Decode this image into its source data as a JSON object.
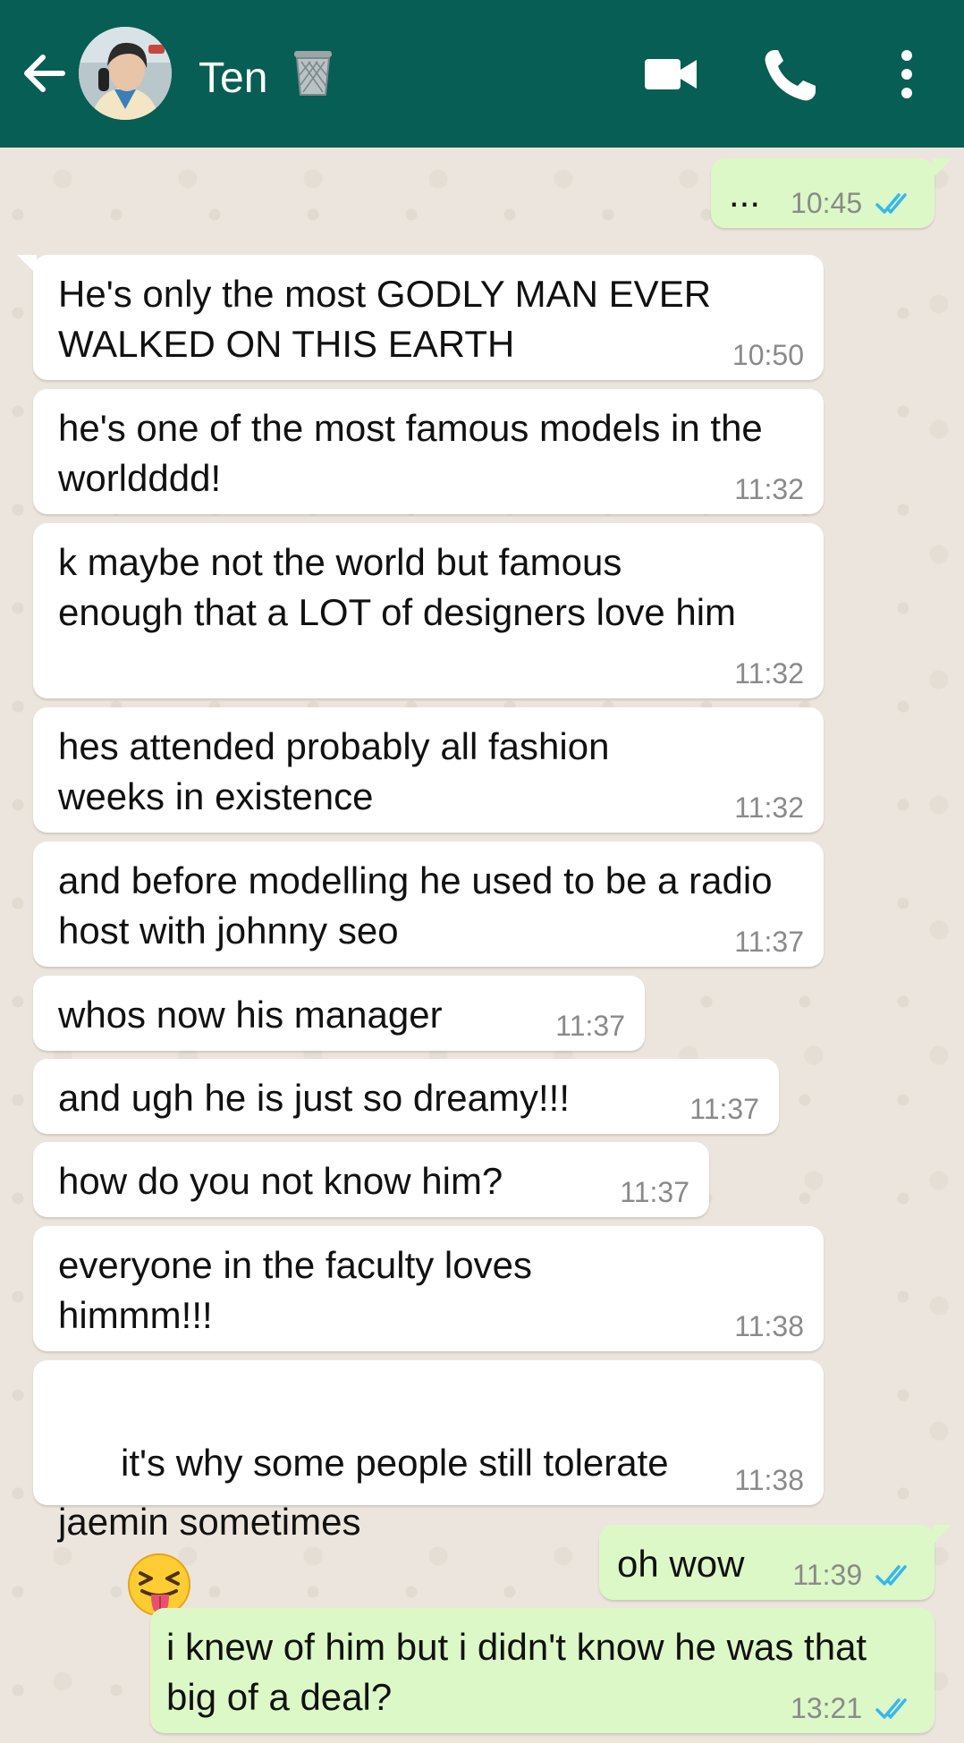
{
  "header": {
    "contact_name": "Ten",
    "colors": {
      "bar": "#075e54",
      "incoming": "#ffffff",
      "outgoing": "#dcf8c6",
      "read_ticks": "#34b7f1"
    }
  },
  "messages": [
    {
      "direction": "out",
      "text": "...",
      "time": "10:45",
      "status": "read"
    },
    {
      "direction": "in",
      "text": "He's only the most GODLY MAN EVER WALKED ON THIS EARTH",
      "time": "10:50"
    },
    {
      "direction": "in",
      "text": "he's one of the most famous models in the worldddd!",
      "time": "11:32"
    },
    {
      "direction": "in",
      "text": "k maybe not the world but famous enough that a LOT of designers love him",
      "time": "11:32"
    },
    {
      "direction": "in",
      "text": "hes attended probably all fashion weeks in existence",
      "time": "11:32"
    },
    {
      "direction": "in",
      "text": "and before modelling he used to be a radio host with johnny seo",
      "time": "11:37"
    },
    {
      "direction": "in",
      "text": "whos now his manager",
      "time": "11:37"
    },
    {
      "direction": "in",
      "text": "and ugh he is just so dreamy!!!",
      "time": "11:37"
    },
    {
      "direction": "in",
      "text": "how do you not know him?",
      "time": "11:37"
    },
    {
      "direction": "in",
      "text": "everyone in the faculty loves himmm!!!",
      "time": "11:38"
    },
    {
      "direction": "in",
      "text": "it's why some people still tolerate jaemin sometimes",
      "time": "11:38",
      "emoji": "squinting-tongue-emoji"
    },
    {
      "direction": "out",
      "text": "oh wow",
      "time": "11:39",
      "status": "read"
    },
    {
      "direction": "out",
      "text": "i knew of him but i didn't know he was that big of a deal?",
      "time": "13:21",
      "status": "read"
    }
  ]
}
